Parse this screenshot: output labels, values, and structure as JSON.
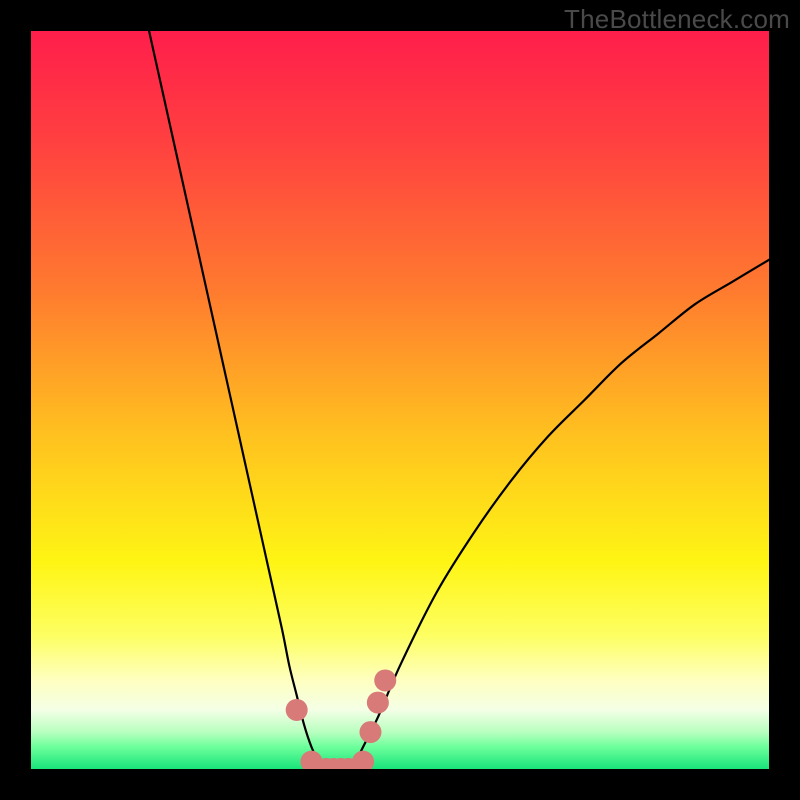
{
  "watermark": "TheBottleneck.com",
  "gradient_stops": [
    {
      "offset": 0.0,
      "color": "#ff1e4b"
    },
    {
      "offset": 0.15,
      "color": "#ff4040"
    },
    {
      "offset": 0.35,
      "color": "#ff7a2f"
    },
    {
      "offset": 0.55,
      "color": "#ffc21f"
    },
    {
      "offset": 0.72,
      "color": "#fef514"
    },
    {
      "offset": 0.82,
      "color": "#fdff63"
    },
    {
      "offset": 0.88,
      "color": "#feffc0"
    },
    {
      "offset": 0.92,
      "color": "#f4ffe6"
    },
    {
      "offset": 0.95,
      "color": "#b8ffbf"
    },
    {
      "offset": 0.97,
      "color": "#6dff9c"
    },
    {
      "offset": 1.0,
      "color": "#18e47a"
    }
  ],
  "chart_data": {
    "type": "line",
    "title": "",
    "xlabel": "",
    "ylabel": "",
    "xlim": [
      0,
      100
    ],
    "ylim": [
      0,
      100
    ],
    "grid": false,
    "legend": false,
    "series": [
      {
        "name": "bottleneck-curve",
        "color": "#000000",
        "x": [
          16,
          18,
          20,
          22,
          24,
          26,
          28,
          30,
          32,
          34,
          35,
          36,
          37,
          38,
          39,
          40,
          41,
          42,
          43,
          44,
          45,
          47,
          50,
          55,
          60,
          65,
          70,
          75,
          80,
          85,
          90,
          95,
          100
        ],
        "y": [
          100,
          91,
          82,
          73,
          64,
          55,
          46,
          37,
          28,
          19,
          14,
          10,
          6,
          3,
          1,
          0,
          0,
          0,
          0,
          1,
          3,
          7,
          14,
          24,
          32,
          39,
          45,
          50,
          55,
          59,
          63,
          66,
          69
        ]
      }
    ],
    "highlight_points": {
      "name": "optimal-zone-markers",
      "color": "#d77a78",
      "x": [
        36,
        38,
        39,
        40,
        41,
        42,
        43,
        44,
        45,
        46,
        47,
        48
      ],
      "y": [
        8,
        1,
        0,
        0,
        0,
        0,
        0,
        0,
        1,
        5,
        9,
        12
      ]
    }
  }
}
